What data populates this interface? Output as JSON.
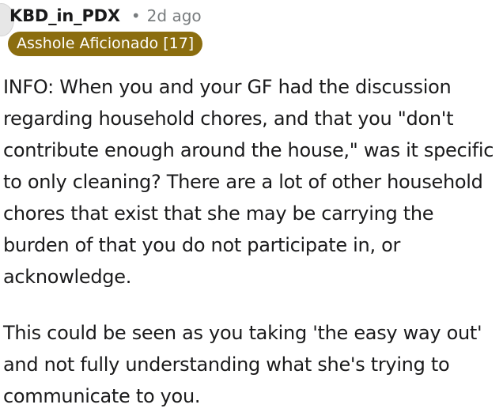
{
  "comment": {
    "username": "KBD_in_PDX",
    "separator": "•",
    "timestamp": "2d ago",
    "flair": "Asshole Aficionado [17]",
    "paragraphs": [
      "INFO: When you and your GF had the discussion regarding household chores, and that you \"don't contribute enough around the house,\" was it specific to only cleaning? There are a lot of other household chores that exist that she may be carrying the burden of that you do not participate in, or acknowledge.",
      "This could be seen as you taking 'the easy way out' and not fully understanding what she's trying to communicate to you."
    ]
  },
  "colors": {
    "flair_background": "#8b6d0f",
    "flair_text": "#ffffff",
    "meta_text": "#787c7e",
    "body_text": "#1a1a1b"
  }
}
